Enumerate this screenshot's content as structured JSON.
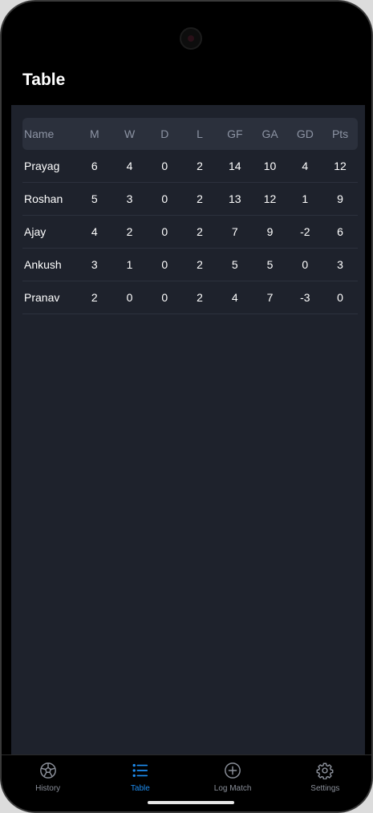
{
  "header": {
    "title": "Table"
  },
  "table": {
    "columns": [
      "Name",
      "M",
      "W",
      "D",
      "L",
      "GF",
      "GA",
      "GD",
      "Pts"
    ],
    "rows": [
      [
        "Prayag",
        "6",
        "4",
        "0",
        "2",
        "14",
        "10",
        "4",
        "12"
      ],
      [
        "Roshan",
        "5",
        "3",
        "0",
        "2",
        "13",
        "12",
        "1",
        "9"
      ],
      [
        "Ajay",
        "4",
        "2",
        "0",
        "2",
        "7",
        "9",
        "-2",
        "6"
      ],
      [
        "Ankush",
        "3",
        "1",
        "0",
        "2",
        "5",
        "5",
        "0",
        "3"
      ],
      [
        "Pranav",
        "2",
        "0",
        "0",
        "2",
        "4",
        "7",
        "-3",
        "0"
      ]
    ]
  },
  "tabbar": {
    "items": [
      {
        "label": "History",
        "icon": "soccer-ball-icon",
        "active": false
      },
      {
        "label": "Table",
        "icon": "list-icon",
        "active": true
      },
      {
        "label": "Log Match",
        "icon": "plus-circle-icon",
        "active": false
      },
      {
        "label": "Settings",
        "icon": "gear-icon",
        "active": false
      }
    ]
  },
  "colors": {
    "accent": "#1e8ef2",
    "background": "#1e222c",
    "header_row": "#2b303c"
  }
}
